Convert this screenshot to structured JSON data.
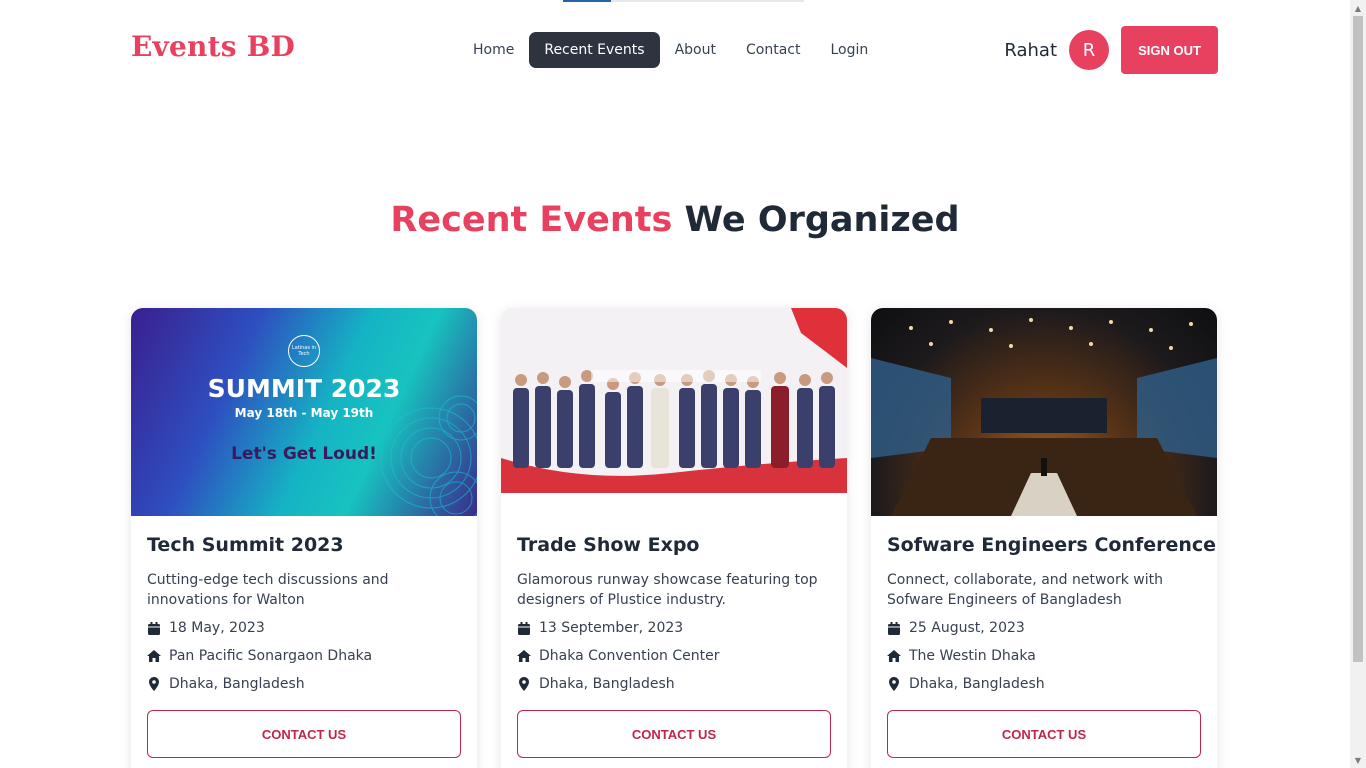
{
  "colors": {
    "brand": "#e8415f",
    "dark_nav": "#2d3440",
    "contact_red": "#c0264a"
  },
  "navbar": {
    "logo": "Events BD",
    "menu": [
      {
        "label": "Home",
        "active": false
      },
      {
        "label": "Recent Events",
        "active": true
      },
      {
        "label": "About",
        "active": false
      },
      {
        "label": "Contact",
        "active": false
      },
      {
        "label": "Login",
        "active": false
      }
    ],
    "user_name": "Rahat",
    "avatar_initial": "R",
    "signout_label": "SIGN OUT"
  },
  "section": {
    "title_accent": "Recent Events",
    "title_rest": "We Organized"
  },
  "cards": [
    {
      "image_text": {
        "badge": "Latinas in Tech",
        "headline": "SUMMIT 2023",
        "dates": "May 18th - May 19th",
        "tagline": "Let's Get Loud!"
      },
      "title": "Tech Summit 2023",
      "description": "Cutting-edge tech discussions and innovations for Walton",
      "date": "18 May, 2023",
      "venue": "Pan Pacific Sonargaon Dhaka",
      "location": "Dhaka, Bangladesh",
      "button": "CONTACT US"
    },
    {
      "title": "Trade Show Expo",
      "description": "Glamorous runway showcase featuring top designers of Plustice industry.",
      "date": "13 September, 2023",
      "venue": "Dhaka Convention Center",
      "location": "Dhaka, Bangladesh",
      "button": "CONTACT US"
    },
    {
      "title": "Sofware Engineers Conference",
      "description": "Connect, collaborate, and network with Sofware Engineers of Bangladesh",
      "date": "25 August, 2023",
      "venue": "The Westin Dhaka",
      "location": "Dhaka, Bangladesh",
      "button": "CONTACT US"
    }
  ],
  "icons": {
    "date": "calendar-icon",
    "venue": "home-icon",
    "location": "map-pin-icon"
  }
}
